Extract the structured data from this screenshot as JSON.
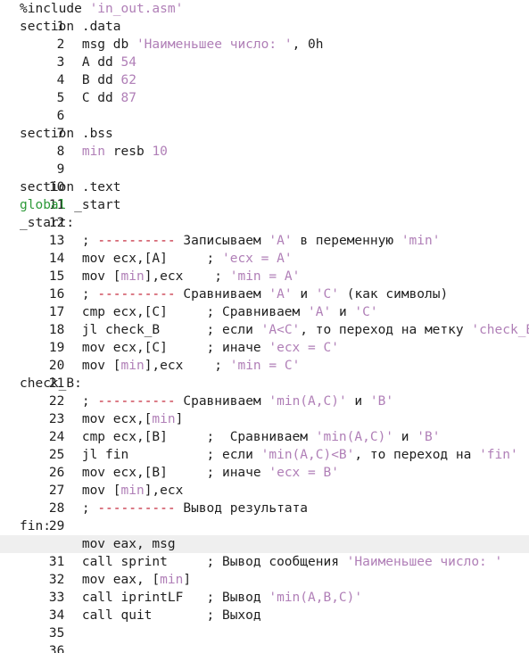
{
  "editor": {
    "current_line": 31,
    "colors": {
      "keyword": "#2e9a3a",
      "string": "#b07fb7",
      "number": "#b07fb7",
      "dashes": "#c0182c",
      "text": "#1f1f1f",
      "current_line_bg": "#efefef"
    },
    "lines": [
      {
        "n": "1",
        "tokens": [
          {
            "t": "%include ",
            "c": "text"
          },
          {
            "t": "'in_out.asm'",
            "c": "str"
          }
        ]
      },
      {
        "n": "2",
        "tokens": [
          {
            "t": "section .data",
            "c": "text"
          }
        ]
      },
      {
        "n": "3",
        "tokens": [
          {
            "t": "        msg db ",
            "c": "text"
          },
          {
            "t": "'Наименьшее число: '",
            "c": "str"
          },
          {
            "t": ", 0h",
            "c": "text"
          }
        ]
      },
      {
        "n": "4",
        "tokens": [
          {
            "t": "        A dd ",
            "c": "text"
          },
          {
            "t": "54",
            "c": "num"
          }
        ]
      },
      {
        "n": "5",
        "tokens": [
          {
            "t": "        B dd ",
            "c": "text"
          },
          {
            "t": "62",
            "c": "num"
          }
        ]
      },
      {
        "n": "6",
        "tokens": [
          {
            "t": "        C dd ",
            "c": "text"
          },
          {
            "t": "87",
            "c": "num"
          }
        ]
      },
      {
        "n": "7",
        "tokens": []
      },
      {
        "n": "8",
        "tokens": [
          {
            "t": "section .bss",
            "c": "text"
          }
        ]
      },
      {
        "n": "9",
        "tokens": [
          {
            "t": "        ",
            "c": "text"
          },
          {
            "t": "min",
            "c": "str"
          },
          {
            "t": " resb ",
            "c": "text"
          },
          {
            "t": "10",
            "c": "num"
          }
        ]
      },
      {
        "n": "10",
        "tokens": []
      },
      {
        "n": "11",
        "tokens": [
          {
            "t": "section .text",
            "c": "text"
          }
        ]
      },
      {
        "n": "12",
        "tokens": [
          {
            "t": "global",
            "c": "kw"
          },
          {
            "t": " _start",
            "c": "text"
          }
        ]
      },
      {
        "n": "13",
        "tokens": [
          {
            "t": "_start:",
            "c": "text"
          }
        ]
      },
      {
        "n": "14",
        "tokens": [
          {
            "t": "        ; ",
            "c": "text"
          },
          {
            "t": "----------",
            "c": "dash"
          },
          {
            "t": " Записываем ",
            "c": "text"
          },
          {
            "t": "'A'",
            "c": "str"
          },
          {
            "t": " в переменную ",
            "c": "text"
          },
          {
            "t": "'min'",
            "c": "str"
          }
        ]
      },
      {
        "n": "15",
        "tokens": [
          {
            "t": "        mov ecx,[A]     ; ",
            "c": "text"
          },
          {
            "t": "'ecx = A'",
            "c": "str"
          }
        ]
      },
      {
        "n": "16",
        "tokens": [
          {
            "t": "        mov [",
            "c": "text"
          },
          {
            "t": "min",
            "c": "str"
          },
          {
            "t": "],ecx    ; ",
            "c": "text"
          },
          {
            "t": "'min = A'",
            "c": "str"
          }
        ]
      },
      {
        "n": "17",
        "tokens": [
          {
            "t": "        ; ",
            "c": "text"
          },
          {
            "t": "----------",
            "c": "dash"
          },
          {
            "t": " Сравниваем ",
            "c": "text"
          },
          {
            "t": "'A'",
            "c": "str"
          },
          {
            "t": " и ",
            "c": "text"
          },
          {
            "t": "'C'",
            "c": "str"
          },
          {
            "t": " (как символы)",
            "c": "text"
          }
        ]
      },
      {
        "n": "18",
        "tokens": [
          {
            "t": "        cmp ecx,[C]     ; Сравниваем ",
            "c": "text"
          },
          {
            "t": "'A'",
            "c": "str"
          },
          {
            "t": " и ",
            "c": "text"
          },
          {
            "t": "'C'",
            "c": "str"
          }
        ]
      },
      {
        "n": "19",
        "tokens": [
          {
            "t": "        jl check_B      ; если ",
            "c": "text"
          },
          {
            "t": "'A<C'",
            "c": "str"
          },
          {
            "t": ", то переход на метку ",
            "c": "text"
          },
          {
            "t": "'check_B'",
            "c": "str"
          }
        ]
      },
      {
        "n": "20",
        "tokens": [
          {
            "t": "        mov ecx,[C]     ; иначе ",
            "c": "text"
          },
          {
            "t": "'ecx = C'",
            "c": "str"
          }
        ]
      },
      {
        "n": "21",
        "tokens": [
          {
            "t": "        mov [",
            "c": "text"
          },
          {
            "t": "min",
            "c": "str"
          },
          {
            "t": "],ecx    ; ",
            "c": "text"
          },
          {
            "t": "'min = C'",
            "c": "str"
          }
        ]
      },
      {
        "n": "22",
        "tokens": [
          {
            "t": "check_B:",
            "c": "text"
          }
        ]
      },
      {
        "n": "23",
        "tokens": [
          {
            "t": "        ; ",
            "c": "text"
          },
          {
            "t": "----------",
            "c": "dash"
          },
          {
            "t": " Сравниваем ",
            "c": "text"
          },
          {
            "t": "'min(A,C)'",
            "c": "str"
          },
          {
            "t": " и ",
            "c": "text"
          },
          {
            "t": "'B'",
            "c": "str"
          }
        ]
      },
      {
        "n": "24",
        "tokens": [
          {
            "t": "        mov ecx,[",
            "c": "text"
          },
          {
            "t": "min",
            "c": "str"
          },
          {
            "t": "]",
            "c": "text"
          }
        ]
      },
      {
        "n": "25",
        "tokens": [
          {
            "t": "        cmp ecx,[B]     ;  Сравниваем ",
            "c": "text"
          },
          {
            "t": "'min(A,C)'",
            "c": "str"
          },
          {
            "t": " и ",
            "c": "text"
          },
          {
            "t": "'B'",
            "c": "str"
          }
        ]
      },
      {
        "n": "26",
        "tokens": [
          {
            "t": "        jl fin          ; если ",
            "c": "text"
          },
          {
            "t": "'min(A,C)<B'",
            "c": "str"
          },
          {
            "t": ", то переход на ",
            "c": "text"
          },
          {
            "t": "'fin'",
            "c": "str"
          }
        ]
      },
      {
        "n": "27",
        "tokens": [
          {
            "t": "        mov ecx,[B]     ; иначе ",
            "c": "text"
          },
          {
            "t": "'ecx = B'",
            "c": "str"
          }
        ]
      },
      {
        "n": "28",
        "tokens": [
          {
            "t": "        mov [",
            "c": "text"
          },
          {
            "t": "min",
            "c": "str"
          },
          {
            "t": "],ecx",
            "c": "text"
          }
        ]
      },
      {
        "n": "29",
        "tokens": [
          {
            "t": "        ; ",
            "c": "text"
          },
          {
            "t": "----------",
            "c": "dash"
          },
          {
            "t": " Вывод результата",
            "c": "text"
          }
        ]
      },
      {
        "n": "30",
        "tokens": [
          {
            "t": "fin:",
            "c": "text"
          }
        ]
      },
      {
        "n": "31",
        "tokens": [
          {
            "t": "        mov eax, msg",
            "c": "text"
          }
        ]
      },
      {
        "n": "32",
        "tokens": [
          {
            "t": "        call sprint     ; Вывод сообщения ",
            "c": "text"
          },
          {
            "t": "'Наименьшее число: '",
            "c": "str"
          }
        ]
      },
      {
        "n": "33",
        "tokens": [
          {
            "t": "        mov eax, [",
            "c": "text"
          },
          {
            "t": "min",
            "c": "str"
          },
          {
            "t": "]",
            "c": "text"
          }
        ]
      },
      {
        "n": "34",
        "tokens": [
          {
            "t": "        call iprintLF   ; Вывод ",
            "c": "text"
          },
          {
            "t": "'min(A,B,C)'",
            "c": "str"
          }
        ]
      },
      {
        "n": "35",
        "tokens": [
          {
            "t": "        call quit       ; Выход",
            "c": "text"
          }
        ]
      },
      {
        "n": "36",
        "tokens": []
      }
    ]
  }
}
